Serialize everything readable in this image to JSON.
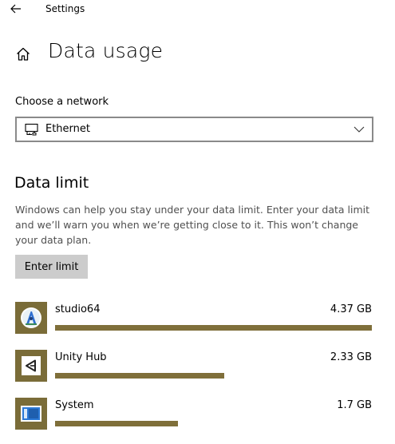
{
  "window": {
    "title": "Settings"
  },
  "page": {
    "title": "Data usage"
  },
  "network": {
    "label": "Choose a network",
    "selected": "Ethernet"
  },
  "data_limit": {
    "title": "Data limit",
    "description": "Windows can help you stay under your data limit. Enter your data limit and we’ll warn you when we’re getting close to it. This won’t change your data plan.",
    "button_label": "Enter limit"
  },
  "apps": [
    {
      "name": "studio64",
      "size": "4.37 GB",
      "usage_fraction": 1.0,
      "icon": "android-studio-icon"
    },
    {
      "name": "Unity Hub",
      "size": "2.33 GB",
      "usage_fraction": 0.533,
      "icon": "unity-hub-icon"
    },
    {
      "name": "System",
      "size": "1.7 GB",
      "usage_fraction": 0.389,
      "icon": "system-icon"
    }
  ],
  "colors": {
    "accent_bar": "#7f6f3a",
    "icon_tile": "#7a6c38",
    "button_bg": "#cccccc"
  }
}
